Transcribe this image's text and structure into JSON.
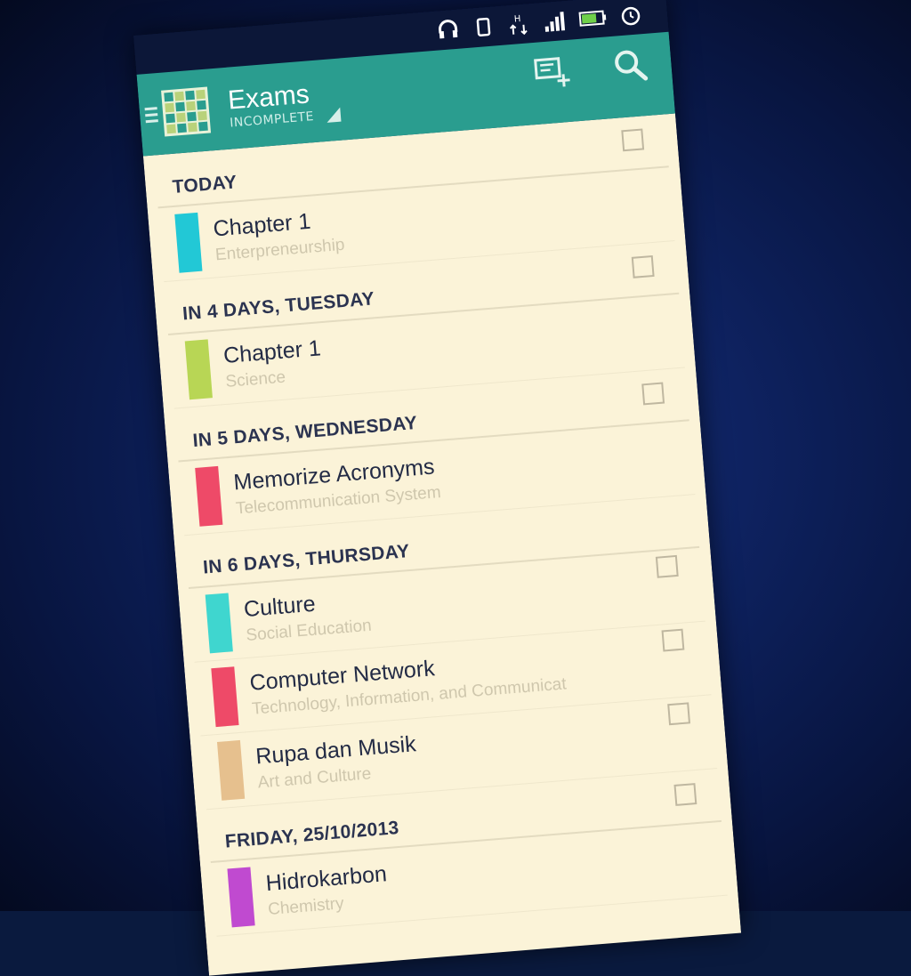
{
  "app": {
    "title": "Exams",
    "subtitle": "INCOMPLETE"
  },
  "colors": {
    "appbar": "#2a9d8f",
    "list_background": "#fbf3d8",
    "cyan": "#22c8d6",
    "lime": "#b8d655",
    "red": "#ee4a68",
    "turquoise": "#3fd6cf",
    "tan": "#e6c08e",
    "purple": "#c04ad0"
  },
  "actions": [
    {
      "icon": "add-task-icon"
    },
    {
      "icon": "search-icon"
    }
  ],
  "sections": [
    {
      "label": "TODAY",
      "items": [
        {
          "title": "Chapter 1",
          "subtitle": "Enterpreneurship",
          "color": "#22c8d6"
        }
      ]
    },
    {
      "label": "IN 4 DAYS, TUESDAY",
      "items": [
        {
          "title": "Chapter 1",
          "subtitle": "Science",
          "color": "#b8d655"
        }
      ]
    },
    {
      "label": "IN 5 DAYS, WEDNESDAY",
      "items": [
        {
          "title": "Memorize Acronyms",
          "subtitle": "Telecommunication System",
          "color": "#ee4a68"
        }
      ]
    },
    {
      "label": "IN 6 DAYS, THURSDAY",
      "items": [
        {
          "title": "Culture",
          "subtitle": "Social Education",
          "color": "#3fd6cf"
        },
        {
          "title": "Computer Network",
          "subtitle": "Technology, Information, and Communicat",
          "color": "#ee4a68"
        },
        {
          "title": "Rupa dan Musik",
          "subtitle": "Art and Culture",
          "color": "#e6c08e"
        }
      ]
    },
    {
      "label": "FRIDAY, 25/10/2013",
      "items": [
        {
          "title": "Hidrokarbon",
          "subtitle": "Chemistry",
          "color": "#c04ad0"
        }
      ]
    }
  ]
}
